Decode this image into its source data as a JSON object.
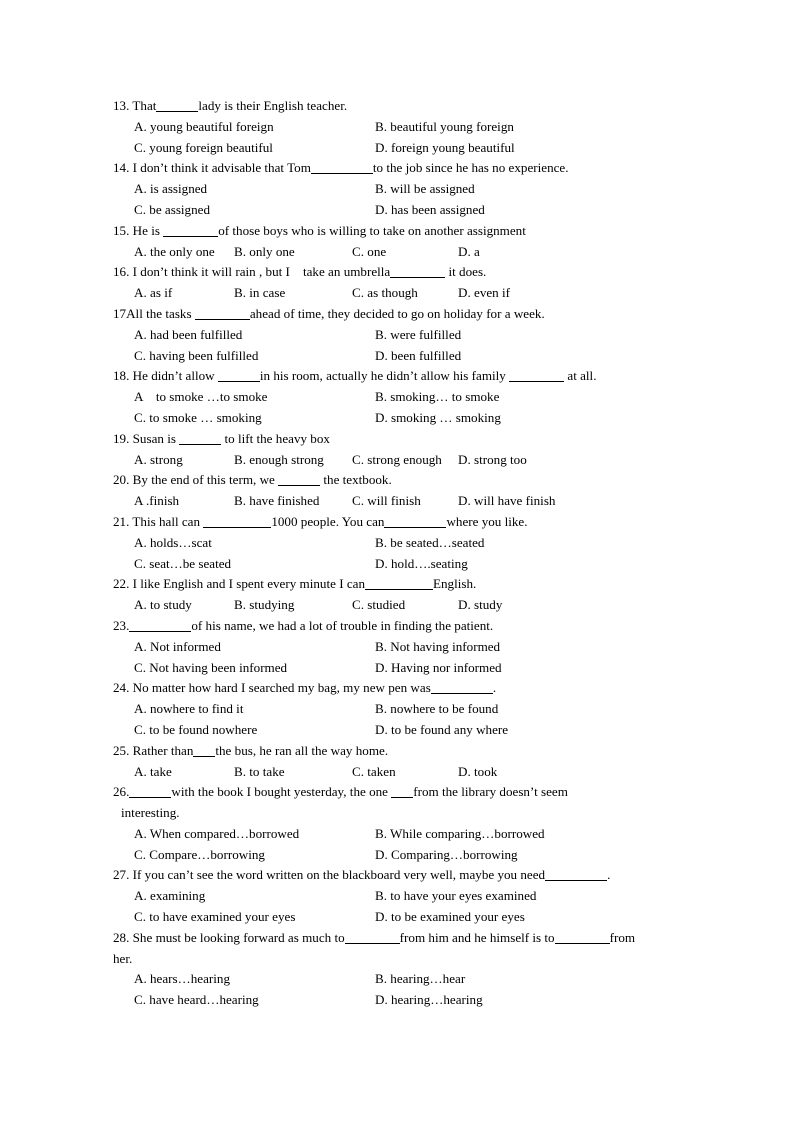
{
  "document": {
    "type": "english-grammar-multiple-choice-worksheet",
    "page_background": "#ffffff",
    "text_color": "#000000"
  },
  "questions": [
    {
      "number": "13.",
      "stem_pre": " That",
      "blank": "b-md",
      "stem_post": "lady is their English teacher.",
      "layout": "two-column",
      "options": [
        {
          "label": "A.",
          "text": " young beautiful foreign"
        },
        {
          "label": "B.",
          "text": " beautiful young foreign"
        },
        {
          "label": "C.",
          "text": " young foreign beautiful"
        },
        {
          "label": "D.",
          "text": " foreign young beautiful"
        }
      ]
    },
    {
      "number": "14.",
      "stem_pre": " I don’t think it advisable that Tom",
      "blank": "b-xl",
      "stem_post": "to the job since he has no experience.",
      "layout": "two-column",
      "options": [
        {
          "label": "A.",
          "text": " is assigned"
        },
        {
          "label": "B.",
          "text": " will be assigned"
        },
        {
          "label": "C.",
          "text": " be assigned"
        },
        {
          "label": "D.",
          "text": " has been assigned"
        }
      ]
    },
    {
      "number": "15.",
      "stem_pre": " He is ",
      "blank": "b-lg",
      "stem_post": "of those boys who is willing to take on another assignment",
      "layout": "four-column",
      "options": [
        {
          "label": "A.",
          "text": " the only one"
        },
        {
          "label": "B.",
          "text": " only one"
        },
        {
          "label": "C.",
          "text": " one"
        },
        {
          "label": "D.",
          "text": " a"
        }
      ]
    },
    {
      "number": "16.",
      "stem_pre": " I don’t think it will rain , but I    take an umbrella",
      "blank": "b-lg",
      "stem_post": " it does.",
      "layout": "four-column",
      "options": [
        {
          "label": "A.",
          "text": " as if"
        },
        {
          "label": "B.",
          "text": " in case"
        },
        {
          "label": "C.",
          "text": " as though"
        },
        {
          "label": "D.",
          "text": " even if"
        }
      ]
    },
    {
      "number": "17",
      "stem_pre": "All the tasks ",
      "blank": "b-lg",
      "stem_post": "ahead of time, they decided to go on holiday for a week.",
      "layout": "two-column",
      "options": [
        {
          "label": "A.",
          "text": " had been fulfilled"
        },
        {
          "label": "B.",
          "text": " were fulfilled"
        },
        {
          "label": "C.",
          "text": " having been fulfilled"
        },
        {
          "label": "D.",
          "text": " been fulfilled"
        }
      ]
    },
    {
      "number": "18.",
      "stem_pre": " He didn’t allow ",
      "blank": "b-md",
      "stem_post": "in his room, actually he didn’t allow his family ",
      "blank2": "b-lg",
      "stem_post2": " at all.",
      "layout": "two-column",
      "options": [
        {
          "label": "A",
          "text": "    to smoke …to smoke"
        },
        {
          "label": "B.",
          "text": " smoking… to smoke"
        },
        {
          "label": "C.",
          "text": " to smoke … smoking"
        },
        {
          "label": "D.",
          "text": " smoking … smoking"
        }
      ]
    },
    {
      "number": "19.",
      "stem_pre": " Susan is ",
      "blank": "b-md",
      "stem_post": " to lift the heavy box",
      "layout": "four-column",
      "options": [
        {
          "label": "A.",
          "text": " strong"
        },
        {
          "label": "B.",
          "text": " enough strong"
        },
        {
          "label": "C.",
          "text": " strong enough"
        },
        {
          "label": "D.",
          "text": " strong too"
        }
      ]
    },
    {
      "number": "20.",
      "stem_pre": " By the end of this term, we ",
      "blank": "b-md",
      "stem_post": " the textbook.",
      "layout": "four-column",
      "options": [
        {
          "label": "A",
          "text": " .finish"
        },
        {
          "label": "B.",
          "text": " have finished"
        },
        {
          "label": "C.",
          "text": " will finish"
        },
        {
          "label": "D.",
          "text": " will have finish"
        }
      ]
    },
    {
      "number": "21.",
      "stem_pre": " This hall can ",
      "blank": "b-xxl",
      "stem_post": "1000 people. You can",
      "blank2": "b-xl",
      "stem_post2": "where you like.",
      "layout": "two-column",
      "options": [
        {
          "label": "A.",
          "text": " holds…scat"
        },
        {
          "label": "B.",
          "text": " be seated…seated"
        },
        {
          "label": "C.",
          "text": " seat…be seated"
        },
        {
          "label": "D.",
          "text": " hold….seating"
        }
      ]
    },
    {
      "number": "22.",
      "stem_pre": " I like English and I spent every minute I can",
      "blank": "b-xxl",
      "stem_post": "English.",
      "layout": "four-column",
      "options": [
        {
          "label": "A.",
          "text": " to study"
        },
        {
          "label": "B.",
          "text": " studying"
        },
        {
          "label": "C.",
          "text": " studied"
        },
        {
          "label": "D.",
          "text": " study"
        }
      ]
    },
    {
      "number": "23.",
      "stem_pre": "",
      "blank": "b-xl",
      "stem_post": "of his name, we had a lot of trouble in finding the patient.",
      "layout": "two-column",
      "options": [
        {
          "label": "A.",
          "text": " Not informed"
        },
        {
          "label": "B.",
          "text": " Not having informed"
        },
        {
          "label": "C.",
          "text": " Not having been informed"
        },
        {
          "label": "D.",
          "text": " Having nor informed"
        }
      ]
    },
    {
      "number": "24.",
      "stem_pre": " No matter how hard I searched my bag, my new pen was",
      "blank": "b-xl",
      "stem_post": ".",
      "layout": "two-column",
      "options": [
        {
          "label": "A.",
          "text": " nowhere to find it"
        },
        {
          "label": "B.",
          "text": " nowhere to be found"
        },
        {
          "label": "C.",
          "text": " to be found nowhere"
        },
        {
          "label": "D.",
          "text": " to be found any where"
        }
      ]
    },
    {
      "number": "25.",
      "stem_pre": " Rather than",
      "blank": "b-tiny",
      "stem_post": "the bus, he ran all the way home.",
      "layout": "four-column",
      "options": [
        {
          "label": "A.",
          "text": " take"
        },
        {
          "label": "B.",
          "text": " to take"
        },
        {
          "label": "C.",
          "text": " taken"
        },
        {
          "label": "D.",
          "text": " took"
        }
      ]
    },
    {
      "number": "26.",
      "justified": true,
      "stem_pre": "",
      "blank": "b-md",
      "stem_post": "with the book I bought yesterday, the one ",
      "blank2": "b-tiny",
      "stem_post2": "from the library doesn’t seem",
      "stem_line2": "interesting.",
      "layout": "two-column",
      "options": [
        {
          "label": "A.",
          "text": " When compared…borrowed"
        },
        {
          "label": "B.",
          "text": " While comparing…borrowed"
        },
        {
          "label": "C.",
          "text": " Compare…borrowing"
        },
        {
          "label": "D.",
          "text": " Comparing…borrowing"
        }
      ]
    },
    {
      "number": "27.",
      "stem_pre": " If you can’t see the word written on the blackboard very well, maybe you need",
      "blank": "b-xl",
      "stem_post": ".",
      "layout": "two-column",
      "options": [
        {
          "label": "A.",
          "text": " examining"
        },
        {
          "label": "B.",
          "text": " to have your eyes examined"
        },
        {
          "label": "C.",
          "text": " to have examined your eyes"
        },
        {
          "label": "D.",
          "text": " to be examined your eyes"
        }
      ]
    },
    {
      "number": "28.",
      "stem_pre": " She must be looking forward as much to",
      "blank": "b-lg",
      "stem_post": "from him and he himself is to",
      "blank2": "b-lg",
      "stem_post2": "from",
      "stem_line2": "her.",
      "layout": "two-column",
      "options": [
        {
          "label": "A.",
          "text": " hears…hearing"
        },
        {
          "label": "B.",
          "text": " hearing…hear"
        },
        {
          "label": "C.",
          "text": " have heard…hearing"
        },
        {
          "label": "D.",
          "text": " hearing…hearing"
        }
      ]
    }
  ],
  "layout_columns": {
    "two_column": [
      21,
      262
    ],
    "four_column": [
      21,
      121,
      239,
      345
    ]
  }
}
